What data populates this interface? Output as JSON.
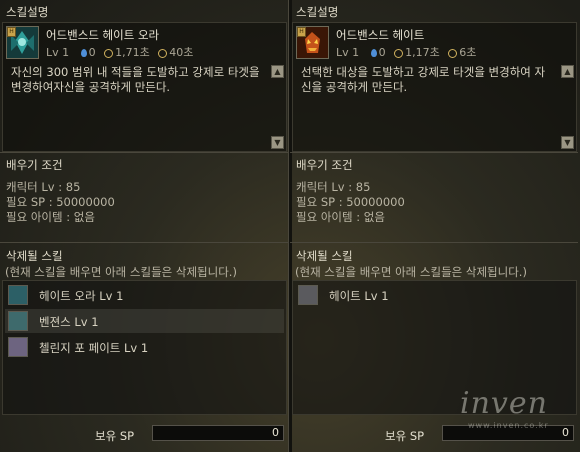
{
  "left": {
    "section_title": "스킬설명",
    "skill": {
      "name": "어드밴스드 헤이트 오라",
      "level": "Lv 1",
      "mp": "0",
      "cast_time": "1,71초",
      "cooldown": "40초",
      "description": "자신의 300 범위 내 적들을 도발하고 강제로 타겟을 변경하여자신을 공격하게 만든다.",
      "icon": "hate-aura-icon"
    },
    "learn_title": "배우기 조건",
    "char_lv": "캐릭터 Lv : 85",
    "req_sp": "필요 SP : 50000000",
    "req_item": "필요 아이템 : 없음",
    "deleted_title": "삭제될 스킬",
    "deleted_note": "(현재 스킬을 배우면 아래 스킬들은 삭제됩니다.)",
    "deleted_skills": [
      {
        "label": "헤이트 오라 Lv 1",
        "icon": "hate-aura-small-icon"
      },
      {
        "label": "벤젼스 Lv 1",
        "icon": "vengeance-icon"
      },
      {
        "label": "첼린지 포 페이트 Lv 1",
        "icon": "challenge-for-fate-icon"
      }
    ],
    "sp_label": "보유 SP",
    "sp_value": "0"
  },
  "right": {
    "section_title": "스킬설명",
    "skill": {
      "name": "어드밴스드 헤이트",
      "level": "Lv 1",
      "mp": "0",
      "cast_time": "1,17초",
      "cooldown": "6초",
      "description": "선택한 대상을 도발하고 강제로 타겟을 변경하여 자신을 공격하게 만든다.",
      "icon": "advanced-hate-icon"
    },
    "learn_title": "배우기 조건",
    "char_lv": "캐릭터 Lv : 85",
    "req_sp": "필요 SP : 50000000",
    "req_item": "필요 아이템 : 없음",
    "deleted_title": "삭제될 스킬",
    "deleted_note": "(현재 스킬을 배우면 아래 스킬들은 삭제됩니다.)",
    "deleted_skills": [
      {
        "label": "헤이트 Lv 1",
        "icon": "hate-icon"
      }
    ],
    "sp_label": "보유 SP",
    "sp_value": "0"
  },
  "watermark": {
    "text": "inven",
    "sub": "www.inven.co.kr"
  }
}
